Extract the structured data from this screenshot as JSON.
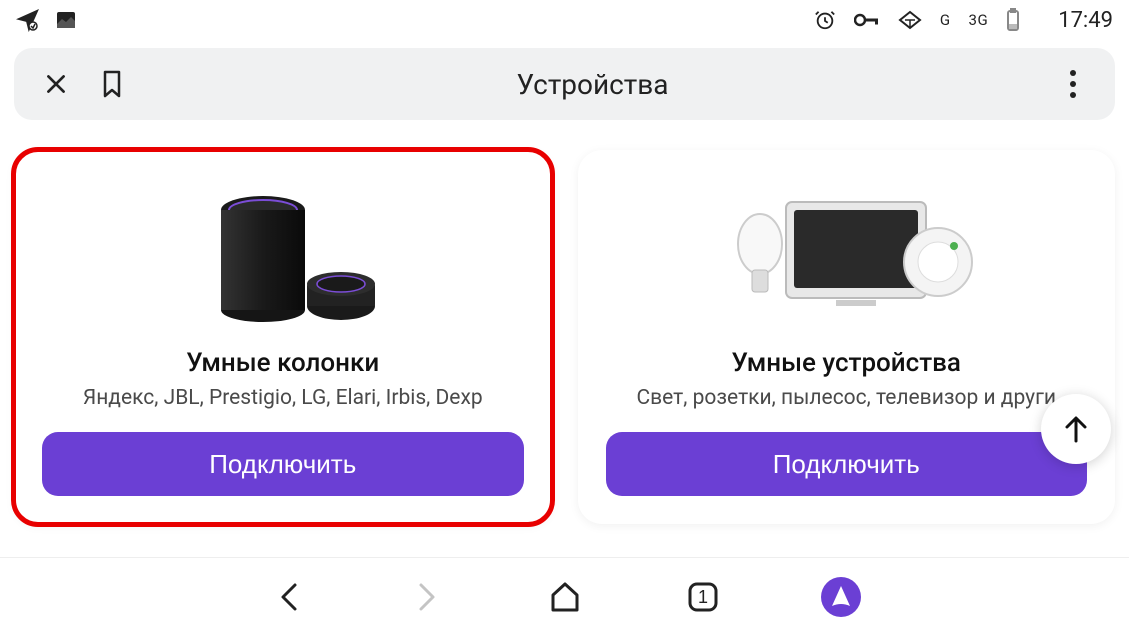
{
  "status": {
    "network1": "G",
    "network2": "3G",
    "time": "17:49"
  },
  "toolbar": {
    "title": "Устройства"
  },
  "cards": [
    {
      "title": "Умные колонки",
      "subtitle": "Яндекс, JBL, Prestigio, LG, Elari, Irbis, Dexp",
      "button": "Подключить"
    },
    {
      "title": "Умные устройства",
      "subtitle": "Свет, розетки, пылесос, телевизор и други",
      "button": "Подключить"
    }
  ],
  "bottom_nav": {
    "tab_count": "1"
  }
}
